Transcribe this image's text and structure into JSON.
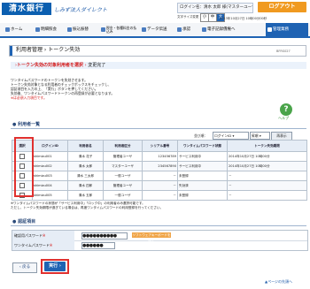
{
  "header": {
    "logo_text": "清水銀行",
    "logo_sub": "しみず法人ダイレクト",
    "login_info": "ログイン名：清水 太郎 様(マスターユーザ)",
    "logout_label": "ログアウト",
    "size_label": "文字サイズ変更",
    "size_buttons": [
      "小",
      "中",
      "大"
    ],
    "timestamp": "2013年10月27日 10時00分00秒"
  },
  "nav": {
    "items": [
      "ホーム",
      "明細照会",
      "振込振替",
      "税金・各種料金の払込み",
      "データ伝送",
      "承認",
      "電子記録債権へ",
      "管理業務"
    ],
    "active_index": 7
  },
  "page": {
    "title": "利用者管理 › トークン失効",
    "code": "BFRS027",
    "steps": {
      "current": "トークン失効の対象利用者を選択",
      "arrow": "›",
      "next": "変更完了"
    },
    "help_label": "ヘルプ",
    "desc_lines": [
      "ワンタイムパスワードのトークンを失効させます。",
      "トークン失効対象となる利用者のチェックボックスをチェックし、",
      "認証項目を入力の上、「実行」ボタンを押してください。",
      "失効後、ワンタイムパスワードトークンの再登録が必要となります。",
      "※は必須入力項目です。"
    ]
  },
  "user_list": {
    "heading": "利用者一覧",
    "sort_label": "並び順：",
    "sort_value": "ログインID",
    "sort_order": "昇順",
    "sort_button": "再表示",
    "columns": [
      "選択",
      "ログインID",
      "利用者名",
      "利用者区分",
      "シリアル番号",
      "ワンタイムパスワード状態",
      "トークン失効期限"
    ],
    "rows": [
      {
        "login_id": "shimizu001",
        "name": "清水 花子",
        "type": "管理者ユーザ",
        "serial": "123456789",
        "status": "サービス利用中",
        "expiry": "2014年10月27日 10時00分"
      },
      {
        "login_id": "shimizu002",
        "name": "清水 太郎",
        "type": "マスターユーザ",
        "serial": "234567890",
        "status": "サービス利用中",
        "expiry": "2014年10月27日 10時00分"
      },
      {
        "login_id": "shimizu003",
        "name": "清水 三太郎",
        "type": "一般ユーザ",
        "serial": "－",
        "status": "未登録",
        "expiry": "－"
      },
      {
        "login_id": "shimizu004",
        "name": "清水 四郎",
        "type": "管理者ユーザ",
        "serial": "－",
        "status": "失効済",
        "expiry": "－"
      },
      {
        "login_id": "shimizu005",
        "name": "清水 五郎",
        "type": "一般ユーザ",
        "serial": "－",
        "status": "未登録",
        "expiry": "－"
      }
    ],
    "notes": [
      "※ワンタイムパスワードの状態が「サービス利用中」「ロック中」の利用者のみ選択可能です。",
      "ただし、トークン失効期限が過ぎている場合は、再度ワンタイムパスワードの利用登録を行ってください。"
    ]
  },
  "auth": {
    "heading": "認証項目",
    "confirm_label": "確認用パスワード",
    "confirm_value": "●●●●●●●●●●",
    "keyboard_button": "ソフトウェアキーボードを開く",
    "otp_label": "ワンタイムパスワード",
    "otp_value": "●●●●●●",
    "required_mark": "※"
  },
  "actions": {
    "back_label": "戻る",
    "execute_label": "実行",
    "page_top": "ページの先頭へ"
  }
}
